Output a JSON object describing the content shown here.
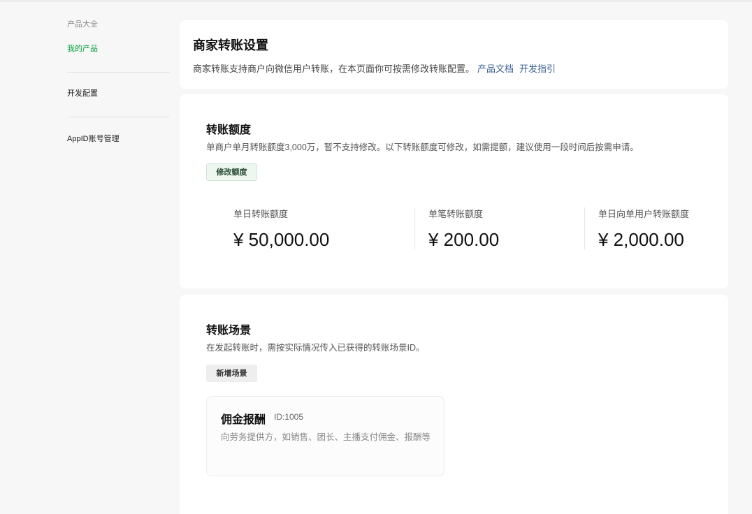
{
  "sidebar": {
    "section_label": "产品大全",
    "active_item": "我的产品",
    "items": [
      {
        "label": "开发配置"
      },
      {
        "label": "AppID账号管理"
      }
    ]
  },
  "header": {
    "title": "商家转账设置",
    "description": "商家转账支持商户向微信用户转账，在本页面你可按需修改转账配置。",
    "links": [
      "产品文档",
      "开发指引"
    ]
  },
  "quota": {
    "title": "转账额度",
    "description": "单商户单月转账额度3,000万，暂不支持修改。以下转账额度可修改，如需提额，建议使用一段时间后按需申请。",
    "button": "修改额度",
    "stats": [
      {
        "label": "单日转账额度",
        "value": "¥ 50,000.00"
      },
      {
        "label": "单笔转账额度",
        "value": "¥ 200.00"
      },
      {
        "label": "单日向单用户转账额度",
        "value": "¥ 2,000.00"
      }
    ]
  },
  "scenes": {
    "title": "转账场景",
    "description": "在发起转账时，需按实际情况传入已获得的转账场景ID。",
    "button": "新增场景",
    "items": [
      {
        "title": "佣金报酬",
        "id": "ID:1005",
        "description": "向劳务提供方，如销售、团长、主播支付佣金、报酬等"
      }
    ]
  },
  "colors": {
    "accent_green": "#07a13f",
    "link_blue": "#3b5f93",
    "background": "#f7f7f7"
  }
}
